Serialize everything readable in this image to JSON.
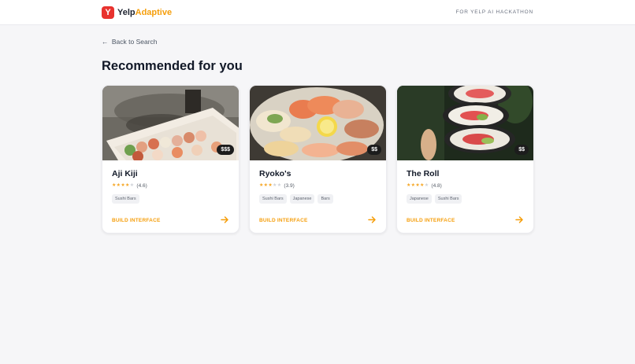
{
  "header": {
    "logo_glyph": "Y",
    "brand_part1": "Yelp",
    "brand_part2": "Adaptive",
    "right_text": "FOR YELP AI HACKATHON"
  },
  "nav": {
    "back_label": "Back to Search"
  },
  "main": {
    "title": "Recommended for you"
  },
  "colors": {
    "accent": "#f59e0b",
    "logo": "#e8322e",
    "star": "#f5a623"
  },
  "cards": [
    {
      "name": "Aji Kiji",
      "price": "$$$",
      "rating": "(4.6)",
      "stars_filled": 4,
      "tags": [
        "Sushi Bars"
      ],
      "cta": "BUILD INTERFACE"
    },
    {
      "name": "Ryoko's",
      "price": "$$",
      "rating": "(3.9)",
      "stars_filled": 3,
      "tags": [
        "Sushi Bars",
        "Japanese",
        "Bars"
      ],
      "cta": "BUILD INTERFACE"
    },
    {
      "name": "The Roll",
      "price": "$$",
      "rating": "(4.8)",
      "stars_filled": 4,
      "tags": [
        "Japanese",
        "Sushi Bars"
      ],
      "cta": "BUILD INTERFACE"
    }
  ]
}
